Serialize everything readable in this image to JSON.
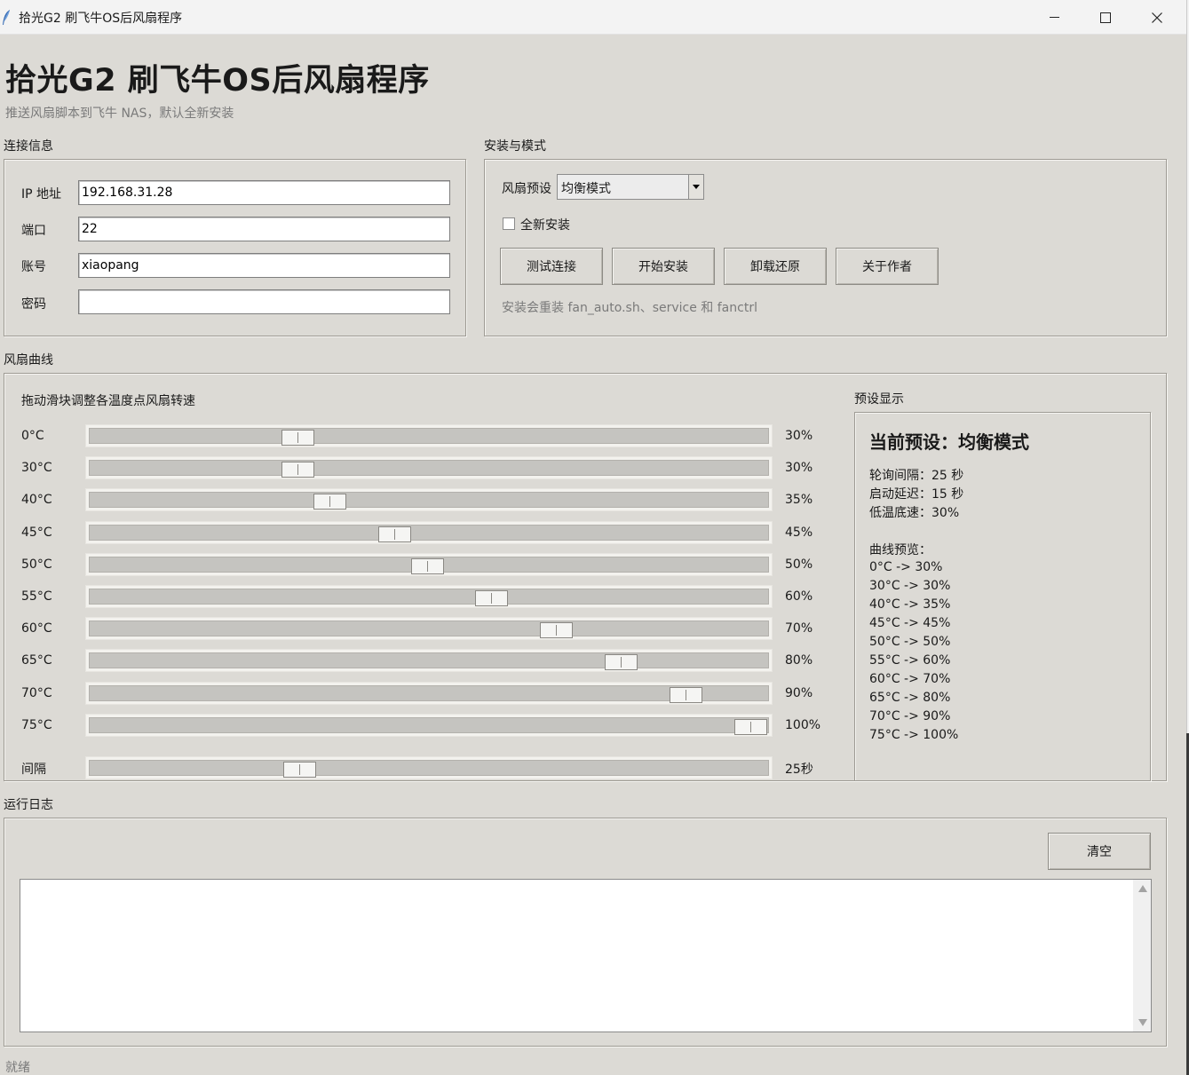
{
  "window": {
    "title": "拾光G2 刷飞牛OS后风扇程序"
  },
  "header": {
    "title": "拾光G2 刷飞牛OS后风扇程序",
    "subtitle": "推送风扇脚本到飞牛 NAS，默认全新安装"
  },
  "connection": {
    "section_label": "连接信息",
    "fields": [
      {
        "label": "IP 地址",
        "value": "192.168.31.28"
      },
      {
        "label": "端口",
        "value": "22"
      },
      {
        "label": "账号",
        "value": "xiaopang"
      },
      {
        "label": "密码",
        "value": ""
      }
    ]
  },
  "install": {
    "section_label": "安装与模式",
    "preset_label": "风扇预设",
    "preset_value": "均衡模式",
    "fresh_install_label": "全新安装",
    "fresh_install_checked": false,
    "buttons": {
      "test": "测试连接",
      "start": "开始安装",
      "uninstall": "卸载还原",
      "about": "关于作者"
    },
    "hint": "安装会重装 fan_auto.sh、service 和 fanctrl"
  },
  "curve": {
    "section_label": "风扇曲线",
    "instruction": "拖动滑块调整各温度点风扇转速",
    "points": [
      {
        "temp": "0°C",
        "percent": 30,
        "label": "30%"
      },
      {
        "temp": "30°C",
        "percent": 30,
        "label": "30%"
      },
      {
        "temp": "40°C",
        "percent": 35,
        "label": "35%"
      },
      {
        "temp": "45°C",
        "percent": 45,
        "label": "45%"
      },
      {
        "temp": "50°C",
        "percent": 50,
        "label": "50%"
      },
      {
        "temp": "55°C",
        "percent": 60,
        "label": "60%"
      },
      {
        "temp": "60°C",
        "percent": 70,
        "label": "70%"
      },
      {
        "temp": "65°C",
        "percent": 80,
        "label": "80%"
      },
      {
        "temp": "70°C",
        "percent": 90,
        "label": "90%"
      },
      {
        "temp": "75°C",
        "percent": 100,
        "label": "100%"
      }
    ],
    "interval": {
      "label": "间隔",
      "value_label": "25秒"
    }
  },
  "preset_display": {
    "section_label": "预设显示",
    "title": "当前预设：均衡模式",
    "lines": [
      "轮询间隔：25 秒",
      "启动延迟：15 秒",
      "低温底速：30%",
      "",
      "曲线预览：",
      "0°C -> 30%",
      "30°C -> 30%",
      "40°C -> 35%",
      "45°C -> 45%",
      "50°C -> 50%",
      "55°C -> 60%",
      "60°C -> 70%",
      "65°C -> 80%",
      "70°C -> 90%",
      "75°C -> 100%"
    ]
  },
  "log": {
    "section_label": "运行日志",
    "clear_label": "清空",
    "content": ""
  },
  "status": {
    "text": "就绪"
  }
}
